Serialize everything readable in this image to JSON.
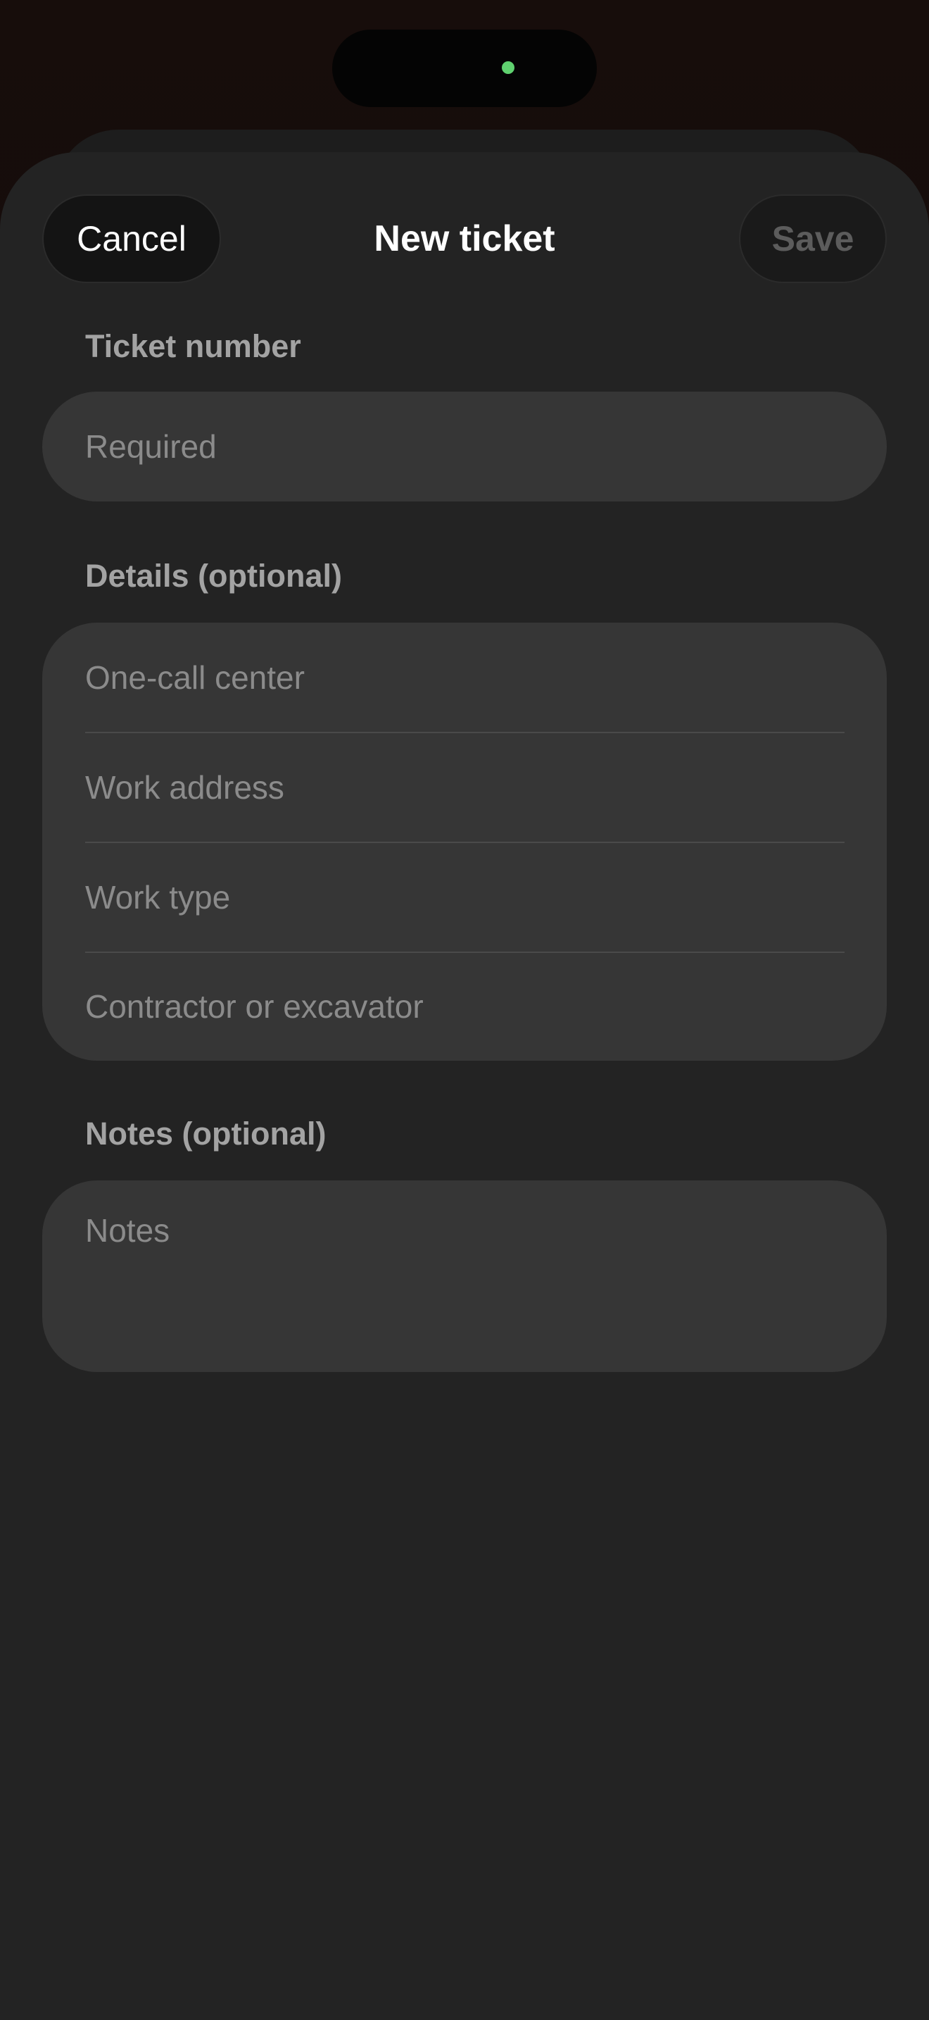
{
  "header": {
    "cancel_label": "Cancel",
    "title": "New ticket",
    "save_label": "Save"
  },
  "ticket_number": {
    "label": "Ticket number",
    "placeholder": "Required"
  },
  "details": {
    "label": "Details (optional)",
    "fields": [
      {
        "placeholder": "One-call center"
      },
      {
        "placeholder": "Work address"
      },
      {
        "placeholder": "Work type"
      },
      {
        "placeholder": "Contractor or excavator"
      }
    ]
  },
  "notes": {
    "label": "Notes (optional)",
    "placeholder": "Notes"
  },
  "colors": {
    "sheet_background": "#232323",
    "field_background": "#363636",
    "camera_indicator": "#5fd16f"
  }
}
